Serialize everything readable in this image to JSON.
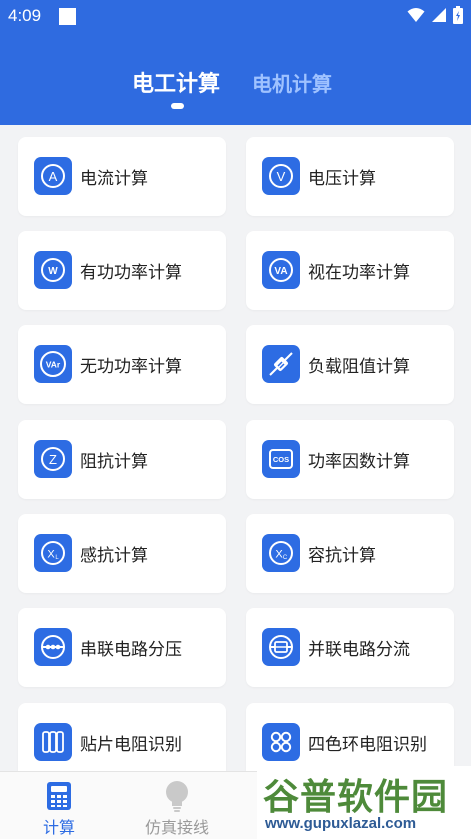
{
  "status_bar": {
    "time": "4:09"
  },
  "tabs": [
    {
      "label": "电工计算",
      "active": true
    },
    {
      "label": "电机计算",
      "active": false
    }
  ],
  "cards": [
    {
      "label": "电流计算",
      "icon": "ammeter-icon"
    },
    {
      "label": "电压计算",
      "icon": "voltmeter-icon"
    },
    {
      "label": "有功功率计算",
      "icon": "watt-icon"
    },
    {
      "label": "视在功率计算",
      "icon": "volt-ampere-icon"
    },
    {
      "label": "无功功率计算",
      "icon": "var-icon"
    },
    {
      "label": "负载阻值计算",
      "icon": "resistor-icon"
    },
    {
      "label": "阻抗计算",
      "icon": "impedance-icon"
    },
    {
      "label": "功率因数计算",
      "icon": "cos-icon"
    },
    {
      "label": "感抗计算",
      "icon": "inductive-reactance-icon"
    },
    {
      "label": "容抗计算",
      "icon": "capacitive-reactance-icon"
    },
    {
      "label": "串联电路分压",
      "icon": "series-circuit-icon"
    },
    {
      "label": "并联电路分流",
      "icon": "parallel-circuit-icon"
    },
    {
      "label": "贴片电阻识别",
      "icon": "smd-resistor-icon"
    },
    {
      "label": "四色环电阻识别",
      "icon": "color-ring-icon"
    }
  ],
  "icon_text": {
    "a": "A",
    "v": "V",
    "w": "W",
    "va": "VA",
    "var": "VAr",
    "z": "Z",
    "cos": "COS",
    "xl": "X",
    "xl_sub": "L",
    "xc": "X",
    "xc_sub": "C"
  },
  "bottom_nav": [
    {
      "label": "计算",
      "icon": "calculator-icon",
      "active": true
    },
    {
      "label": "仿真接线",
      "icon": "lightbulb-icon",
      "active": false
    }
  ],
  "watermark": {
    "title": "谷普软件园",
    "url": "www.gupuxlazal.com"
  },
  "colors": {
    "accent": "#2f6be0",
    "icon_bg": "#2d6ce3",
    "active_nav": "#2d6ce3",
    "inactive_nav": "#9a9a9a"
  }
}
